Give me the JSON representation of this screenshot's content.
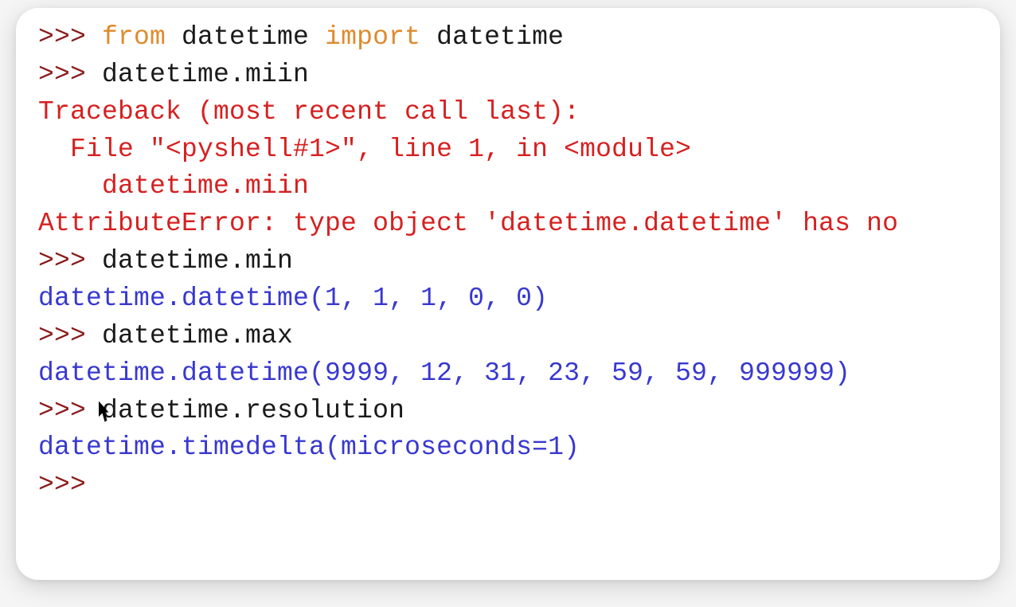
{
  "colors": {
    "prompt": "#8b1a1a",
    "keyword": "#e08a2c",
    "plain": "#1a1a1a",
    "error": "#d62020",
    "output": "#3838d0"
  },
  "shell": {
    "prompt": ">>> ",
    "lines": [
      {
        "type": "input",
        "segments": [
          {
            "cls": "keyword",
            "text": "from"
          },
          {
            "cls": "plain",
            "text": " datetime "
          },
          {
            "cls": "keyword",
            "text": "import"
          },
          {
            "cls": "plain",
            "text": " datetime"
          }
        ]
      },
      {
        "type": "input",
        "segments": [
          {
            "cls": "plain",
            "text": "datetime.miin"
          }
        ]
      },
      {
        "type": "error",
        "text": "Traceback (most recent call last):"
      },
      {
        "type": "error",
        "text": "  File \"<pyshell#1>\", line 1, in <module>"
      },
      {
        "type": "error",
        "text": "    datetime.miin"
      },
      {
        "type": "error",
        "text": "AttributeError: type object 'datetime.datetime' has no"
      },
      {
        "type": "input",
        "segments": [
          {
            "cls": "plain",
            "text": "datetime.min"
          }
        ]
      },
      {
        "type": "output",
        "text": "datetime.datetime(1, 1, 1, 0, 0)"
      },
      {
        "type": "input",
        "segments": [
          {
            "cls": "plain",
            "text": "datetime.max"
          }
        ]
      },
      {
        "type": "output",
        "text": "datetime.datetime(9999, 12, 31, 23, 59, 59, 999999)"
      },
      {
        "type": "input",
        "has_cursor": true,
        "segments": [
          {
            "cls": "plain",
            "text": "datetime.resolution"
          }
        ]
      },
      {
        "type": "output",
        "text": "datetime.timedelta(microseconds=1)"
      },
      {
        "type": "input",
        "segments": []
      }
    ]
  }
}
